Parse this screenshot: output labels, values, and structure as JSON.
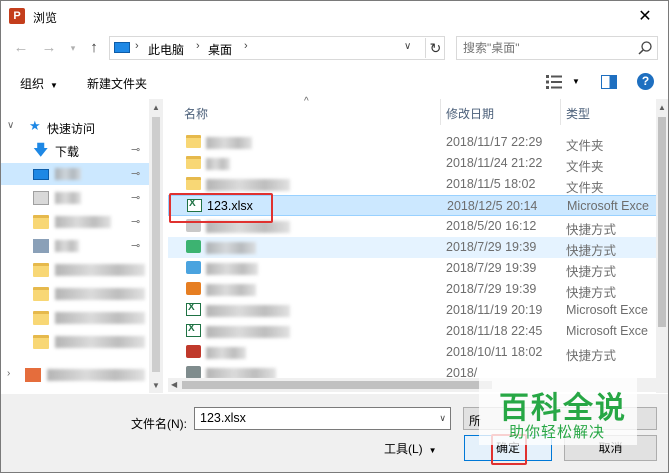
{
  "window": {
    "title": "浏览",
    "app_icon_letter": "P"
  },
  "address": {
    "crumbs": [
      "此电脑",
      "桌面"
    ],
    "separator": "›",
    "search_placeholder": "搜索\"桌面\""
  },
  "toolbar": {
    "organize": "组织",
    "new_folder": "新建文件夹",
    "help": "?"
  },
  "nav": {
    "quick_access": "快速访问",
    "downloads": "下载",
    "pin": "📌"
  },
  "columns": {
    "name": "名称",
    "date": "修改日期",
    "type": "类型"
  },
  "files": [
    {
      "name": "",
      "date": "2018/11/17 22:29",
      "type": "文件夹",
      "icon": "folder-icon"
    },
    {
      "name": "",
      "date": "2018/11/24 21:22",
      "type": "文件夹",
      "icon": "folder-icon"
    },
    {
      "name": "",
      "date": "2018/11/5 18:02",
      "type": "文件夹",
      "icon": "folder-icon"
    },
    {
      "name": "123.xlsx",
      "date": "2018/12/5 20:14",
      "type": "Microsoft Exce",
      "icon": "excel-file-icon"
    },
    {
      "name": "",
      "date": "2018/5/20 16:12",
      "type": "快捷方式",
      "icon": "shortcut-icon"
    },
    {
      "name": "",
      "date": "2018/7/29 19:39",
      "type": "快捷方式",
      "icon": "shortcut-icon"
    },
    {
      "name": "",
      "date": "2018/7/29 19:39",
      "type": "快捷方式",
      "icon": "shortcut-icon"
    },
    {
      "name": "",
      "date": "2018/7/29 19:39",
      "type": "快捷方式",
      "icon": "shortcut-icon"
    },
    {
      "name": "",
      "date": "2018/11/19 20:19",
      "type": "Microsoft Exce",
      "icon": "excel-file-icon"
    },
    {
      "name": "",
      "date": "2018/11/18 22:45",
      "type": "Microsoft Exce",
      "icon": "excel-file-icon"
    },
    {
      "name": "",
      "date": "2018/10/11 18:02",
      "type": "快捷方式",
      "icon": "shortcut-icon"
    },
    {
      "name": "",
      "date": "2018/",
      "type": "",
      "icon": "shortcut-icon"
    }
  ],
  "bottom": {
    "filename_label": "文件名(N):",
    "filename_value": "123.xlsx",
    "filter_label": "所",
    "tools_label": "工具(L)",
    "open_label": "确定",
    "cancel_label": "取消"
  },
  "watermark": {
    "line1": "百科全说",
    "line2": "助你轻松解决"
  },
  "colors": {
    "selection": "#cce8ff",
    "highlight_box": "#e0312f",
    "watermark": "#27a745",
    "accent": "#0078d7"
  }
}
